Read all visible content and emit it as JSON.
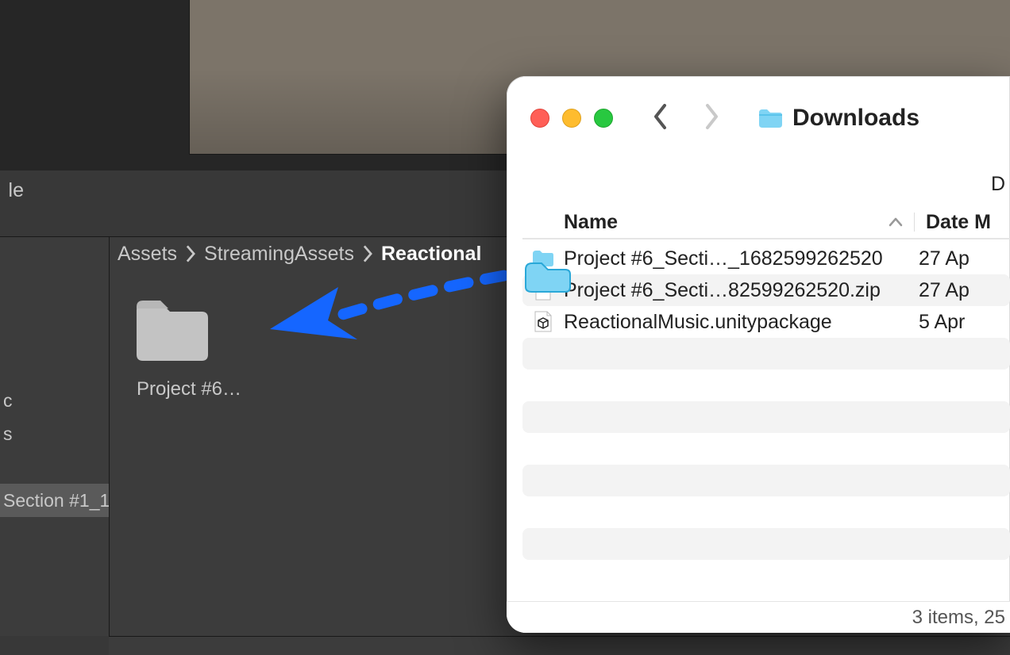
{
  "unity": {
    "console_tab_fragment": "le",
    "breadcrumb": [
      "Assets",
      "StreamingAssets",
      "Reactional"
    ],
    "folder_item_label": "Project #6…",
    "left_items": [
      "c",
      "s",
      ""
    ],
    "left_selected_label": "Section #1_1"
  },
  "finder": {
    "title": "Downloads",
    "second_row_fragment": "D",
    "columns": {
      "name": "Name",
      "date": "Date M"
    },
    "files": [
      {
        "icon": "folder",
        "name": "Project #6_Secti…_1682599262520",
        "date": "27 Ap"
      },
      {
        "icon": "zip",
        "name": "Project #6_Secti…82599262520.zip",
        "date": "27 Ap"
      },
      {
        "icon": "unitypackage",
        "name": "ReactionalMusic.unitypackage",
        "date": "5 Apr"
      }
    ],
    "status": "3 items, 25"
  },
  "colors": {
    "arrow": "#1566ff"
  }
}
